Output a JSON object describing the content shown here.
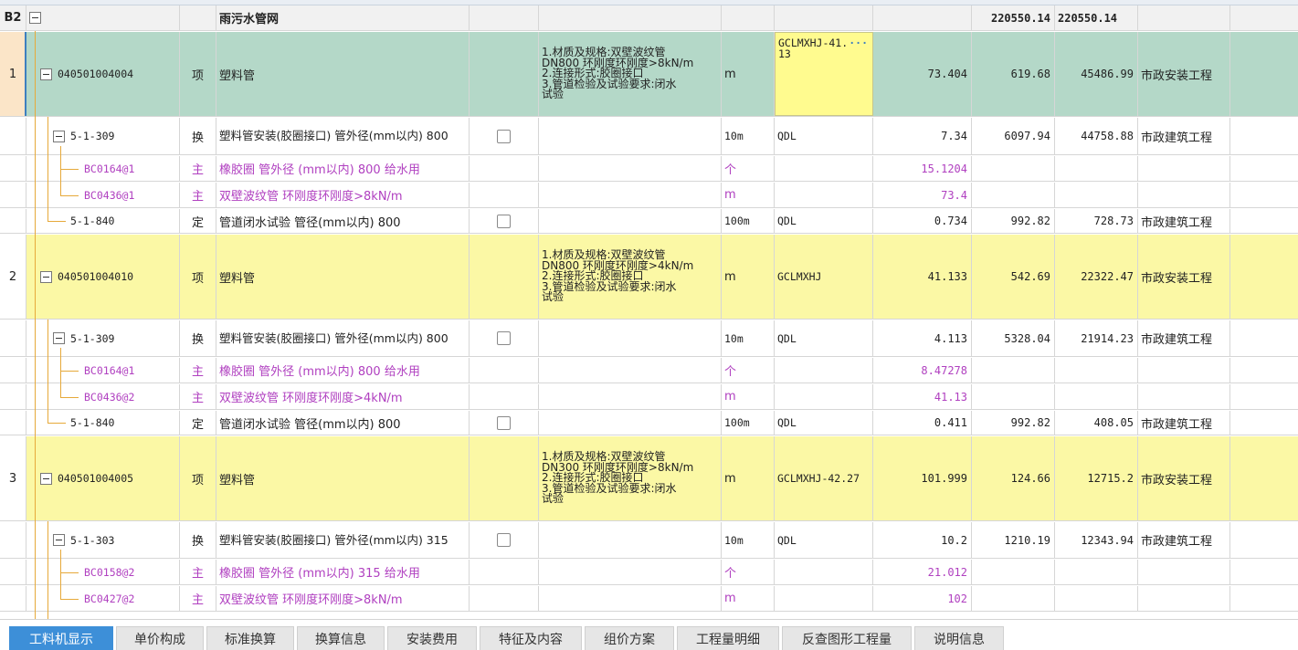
{
  "group": {
    "code": "B2",
    "name": "雨污水管网",
    "total1": "220550.14",
    "total2": "220550.14"
  },
  "rows": [
    {
      "idx": "1",
      "code": "040501004004",
      "type": "项",
      "name": "塑料管",
      "feat": "1.材质及规格:双壁波纹管\nDN800 环刚度环刚度>8kN/m\n2.连接形式:胶圈接口\n3.管道检验及试验要求:闭水\n试验",
      "unit": "m",
      "expr": "GCLMXHJ-41.13",
      "qty": "73.404",
      "price": "619.68",
      "total": "45486.99",
      "prof": "市政安装工程"
    },
    {
      "code": "5-1-309",
      "type": "换",
      "name": "塑料管安装(胶圈接口) 管外径(mm以内) 800",
      "unit": "10m",
      "expr": "QDL",
      "qty": "7.34",
      "price": "6097.94",
      "total": "44758.88",
      "prof": "市政建筑工程"
    },
    {
      "code": "BC0164@1",
      "type": "主",
      "name": "橡胶圈 管外径 (mm以内) 800 给水用",
      "unit": "个",
      "qty": "15.1204"
    },
    {
      "code": "BC0436@1",
      "type": "主",
      "name": "双壁波纹管 环刚度环刚度>8kN/m",
      "unit": "m",
      "qty": "73.4"
    },
    {
      "code": "5-1-840",
      "type": "定",
      "name": "管道闭水试验 管径(mm以内) 800",
      "unit": "100m",
      "expr": "QDL",
      "qty": "0.734",
      "price": "992.82",
      "total": "728.73",
      "prof": "市政建筑工程"
    },
    {
      "idx": "2",
      "code": "040501004010",
      "type": "项",
      "name": "塑料管",
      "feat": "1.材质及规格:双壁波纹管\nDN800 环刚度环刚度>4kN/m\n2.连接形式:胶圈接口\n3.管道检验及试验要求:闭水\n试验",
      "unit": "m",
      "expr": "GCLMXHJ",
      "qty": "41.133",
      "price": "542.69",
      "total": "22322.47",
      "prof": "市政安装工程"
    },
    {
      "code": "5-1-309",
      "type": "换",
      "name": "塑料管安装(胶圈接口) 管外径(mm以内) 800",
      "unit": "10m",
      "expr": "QDL",
      "qty": "4.113",
      "price": "5328.04",
      "total": "21914.23",
      "prof": "市政建筑工程"
    },
    {
      "code": "BC0164@1",
      "type": "主",
      "name": "橡胶圈 管外径 (mm以内) 800 给水用",
      "unit": "个",
      "qty": "8.47278"
    },
    {
      "code": "BC0436@2",
      "type": "主",
      "name": "双壁波纹管 环刚度环刚度>4kN/m",
      "unit": "m",
      "qty": "41.13"
    },
    {
      "code": "5-1-840",
      "type": "定",
      "name": "管道闭水试验 管径(mm以内) 800",
      "unit": "100m",
      "expr": "QDL",
      "qty": "0.411",
      "price": "992.82",
      "total": "408.05",
      "prof": "市政建筑工程"
    },
    {
      "idx": "3",
      "code": "040501004005",
      "type": "项",
      "name": "塑料管",
      "feat": "1.材质及规格:双壁波纹管\nDN300 环刚度环刚度>8kN/m\n2.连接形式:胶圈接口\n3.管道检验及试验要求:闭水\n试验",
      "unit": "m",
      "expr": "GCLMXHJ-42.27",
      "qty": "101.999",
      "price": "124.66",
      "total": "12715.2",
      "prof": "市政安装工程"
    },
    {
      "code": "5-1-303",
      "type": "换",
      "name": "塑料管安装(胶圈接口) 管外径(mm以内) 315",
      "unit": "10m",
      "expr": "QDL",
      "qty": "10.2",
      "price": "1210.19",
      "total": "12343.94",
      "prof": "市政建筑工程"
    },
    {
      "code": "BC0158@2",
      "type": "主",
      "name": "橡胶圈 管外径 (mm以内) 315 给水用",
      "unit": "个",
      "qty": "21.012"
    },
    {
      "code": "BC0427@2",
      "type": "主",
      "name": "双壁波纹管 环刚度环刚度>8kN/m",
      "unit": "m",
      "qty": "102"
    }
  ],
  "tabs": [
    "工料机显示",
    "单价构成",
    "标准换算",
    "换算信息",
    "安装费用",
    "特征及内容",
    "组价方案",
    "工程量明细",
    "反查图形工程量",
    "说明信息"
  ],
  "active_tab": "工料机显示",
  "colors": {
    "selected_row": "#b4d8c8",
    "bill_row": "#fbf8a5",
    "material_text": "#b040c0",
    "active_tab": "#3d8fd8"
  }
}
